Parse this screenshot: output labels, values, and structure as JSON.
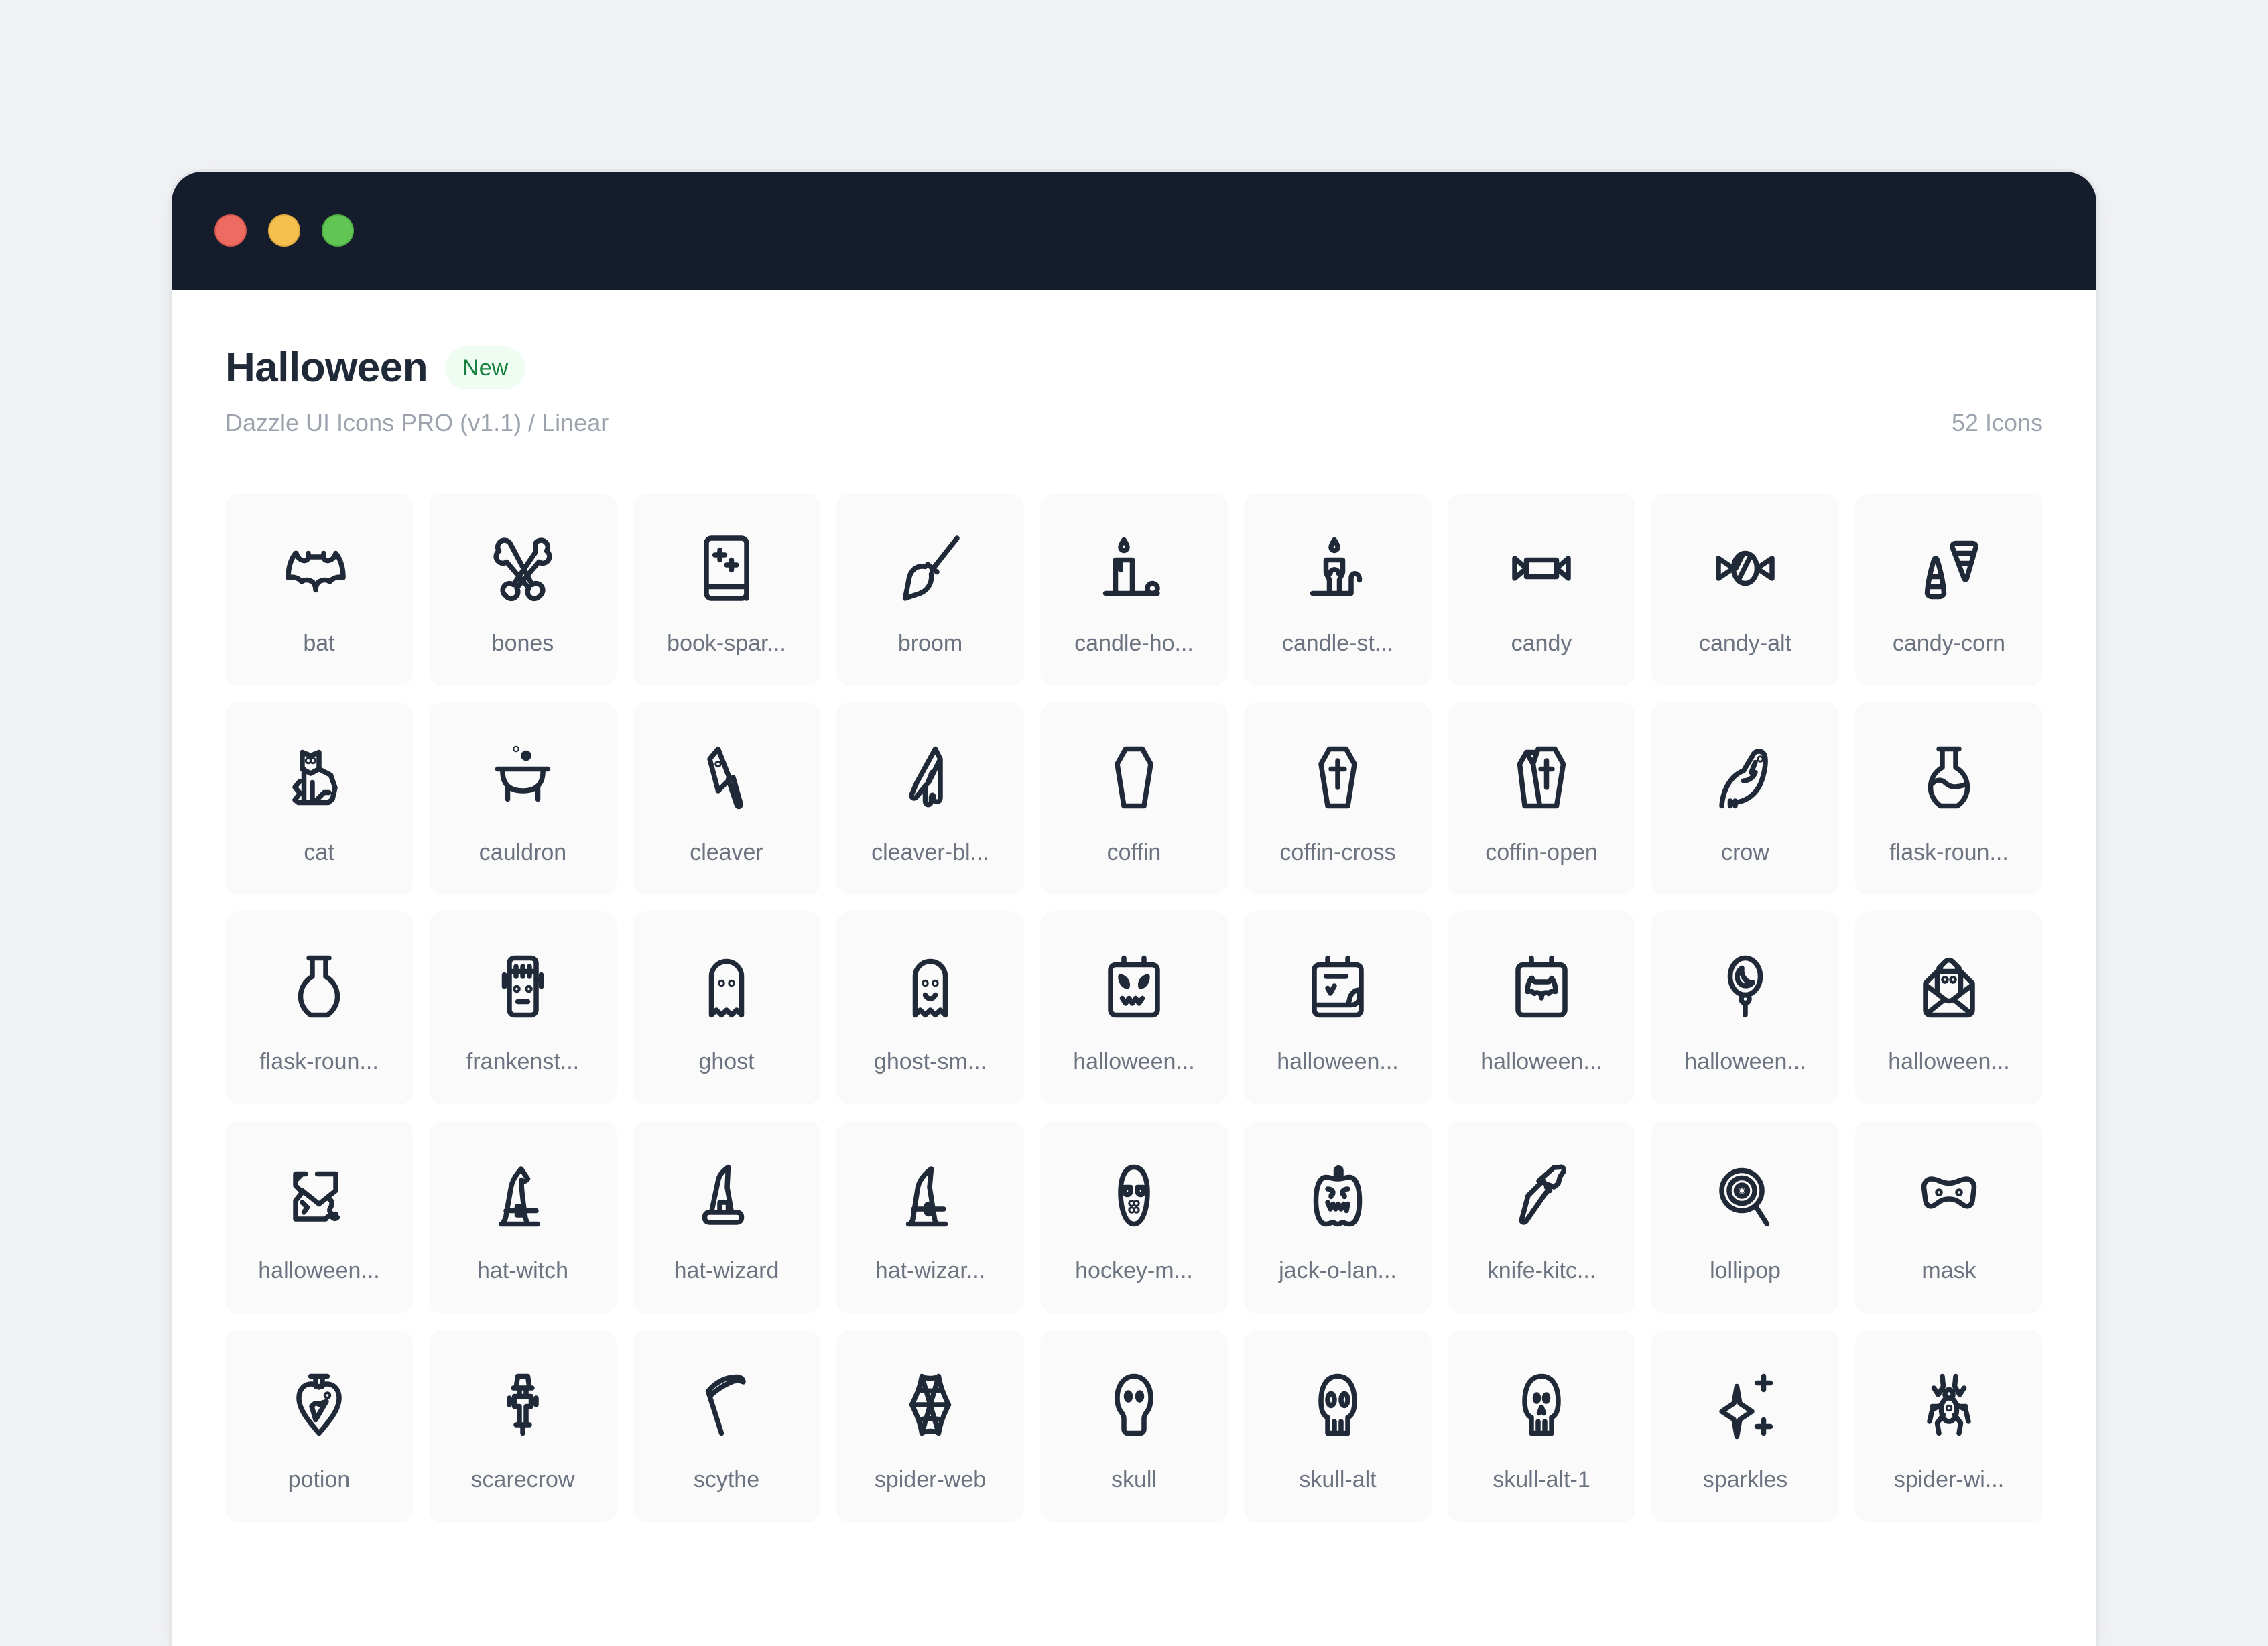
{
  "window": {
    "controls": [
      "close",
      "minimize",
      "maximize"
    ]
  },
  "header": {
    "title": "Halloween",
    "badge": "New",
    "subtitle": "Dazzle UI Icons PRO (v1.1) / Linear",
    "count": "52 Icons"
  },
  "colors": {
    "titlebar": "#151c2c",
    "badge_text": "#15803d",
    "badge_bg": "#effcf2",
    "icon_stroke": "#1f2937"
  },
  "icons": [
    {
      "label": "bat",
      "icon": "bat"
    },
    {
      "label": "bones",
      "icon": "bones"
    },
    {
      "label": "book-spar...",
      "icon": "book-sparkle"
    },
    {
      "label": "broom",
      "icon": "broom"
    },
    {
      "label": "candle-ho...",
      "icon": "candle-holder"
    },
    {
      "label": "candle-st...",
      "icon": "candle-stick"
    },
    {
      "label": "candy",
      "icon": "candy"
    },
    {
      "label": "candy-alt",
      "icon": "candy-alt"
    },
    {
      "label": "candy-corn",
      "icon": "candy-corn"
    },
    {
      "label": "cat",
      "icon": "cat"
    },
    {
      "label": "cauldron",
      "icon": "cauldron"
    },
    {
      "label": "cleaver",
      "icon": "cleaver"
    },
    {
      "label": "cleaver-bl...",
      "icon": "cleaver-blood"
    },
    {
      "label": "coffin",
      "icon": "coffin"
    },
    {
      "label": "coffin-cross",
      "icon": "coffin-cross"
    },
    {
      "label": "coffin-open",
      "icon": "coffin-open"
    },
    {
      "label": "crow",
      "icon": "crow"
    },
    {
      "label": "flask-roun...",
      "icon": "flask-round-potion"
    },
    {
      "label": "flask-roun...",
      "icon": "flask-round"
    },
    {
      "label": "frankenst...",
      "icon": "frankenstein"
    },
    {
      "label": "ghost",
      "icon": "ghost"
    },
    {
      "label": "ghost-sm...",
      "icon": "ghost-smile"
    },
    {
      "label": "halloween...",
      "icon": "halloween-calendar-face"
    },
    {
      "label": "halloween...",
      "icon": "halloween-calendar-check"
    },
    {
      "label": "halloween...",
      "icon": "halloween-calendar-bat"
    },
    {
      "label": "halloween...",
      "icon": "halloween-balloon"
    },
    {
      "label": "halloween...",
      "icon": "halloween-invitation"
    },
    {
      "label": "halloween...",
      "icon": "halloween-ticket"
    },
    {
      "label": "hat-witch",
      "icon": "hat-witch"
    },
    {
      "label": "hat-wizard",
      "icon": "hat-wizard"
    },
    {
      "label": "hat-wizar...",
      "icon": "hat-wizard-alt"
    },
    {
      "label": "hockey-m...",
      "icon": "hockey-mask"
    },
    {
      "label": "jack-o-lan...",
      "icon": "jack-o-lantern"
    },
    {
      "label": "knife-kitc...",
      "icon": "knife-kitchen"
    },
    {
      "label": "lollipop",
      "icon": "lollipop"
    },
    {
      "label": "mask",
      "icon": "mask"
    },
    {
      "label": "potion",
      "icon": "potion"
    },
    {
      "label": "scarecrow",
      "icon": "scarecrow"
    },
    {
      "label": "scythe",
      "icon": "scythe"
    },
    {
      "label": "spider-web",
      "icon": "spider-web"
    },
    {
      "label": "skull",
      "icon": "skull"
    },
    {
      "label": "skull-alt",
      "icon": "skull-alt"
    },
    {
      "label": "skull-alt-1",
      "icon": "skull-alt-1"
    },
    {
      "label": "sparkles",
      "icon": "sparkles"
    },
    {
      "label": "spider-wi...",
      "icon": "spider-widow"
    }
  ]
}
